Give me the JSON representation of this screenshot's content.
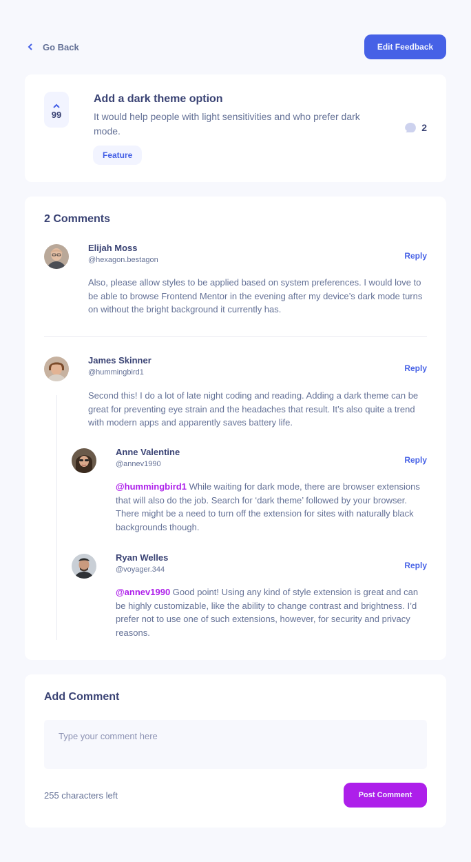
{
  "nav": {
    "back_label": "Go Back",
    "edit_label": "Edit Feedback"
  },
  "feedback": {
    "upvotes": "99",
    "title": "Add a dark theme option",
    "description": "It would help people with light sensitivities and who prefer dark mode.",
    "tag": "Feature",
    "comment_count": "2"
  },
  "comments_section": {
    "title": "2 Comments",
    "comments": [
      {
        "name": "Elijah Moss",
        "handle": "@hexagon.bestagon",
        "reply_label": "Reply",
        "body": "Also, please allow styles to be applied based on system preferences. I would love to be able to browse Frontend Mentor in the evening after my device’s dark mode turns on without the bright background it currently has."
      },
      {
        "name": "James Skinner",
        "handle": "@hummingbird1",
        "reply_label": "Reply",
        "body": "Second this! I do a lot of late night coding and reading. Adding a dark theme can be great for preventing eye strain and the headaches that result. It’s also quite a trend with modern apps and apparently saves battery life.",
        "replies": [
          {
            "name": "Anne Valentine",
            "handle": "@annev1990",
            "reply_label": "Reply",
            "mention": "@hummingbird1",
            "body": " While waiting for dark mode, there are browser extensions that will also do the job. Search for ‘dark theme’ followed by your browser. There might be a need to turn off the extension for sites with naturally black backgrounds though."
          },
          {
            "name": "Ryan Welles",
            "handle": "@voyager.344",
            "reply_label": "Reply",
            "mention": "@annev1990",
            "body": " Good point! Using any kind of style extension is great and can be highly customizable, like the ability to change contrast and brightness. I’d prefer not to use one of such extensions, however, for security and privacy reasons."
          }
        ]
      }
    ]
  },
  "add_comment": {
    "title": "Add Comment",
    "placeholder": "Type your comment here",
    "chars_left": "255 characters left",
    "post_label": "Post Comment"
  },
  "colors": {
    "background": "#f7f8fd",
    "primary_blue": "#4661e6",
    "purple": "#ad1fea",
    "dark_text": "#3a4374",
    "muted_text": "#647196"
  },
  "icons": {
    "back": "chevron-left-icon",
    "upvote": "chevron-up-icon",
    "comments": "comment-bubble-icon"
  }
}
